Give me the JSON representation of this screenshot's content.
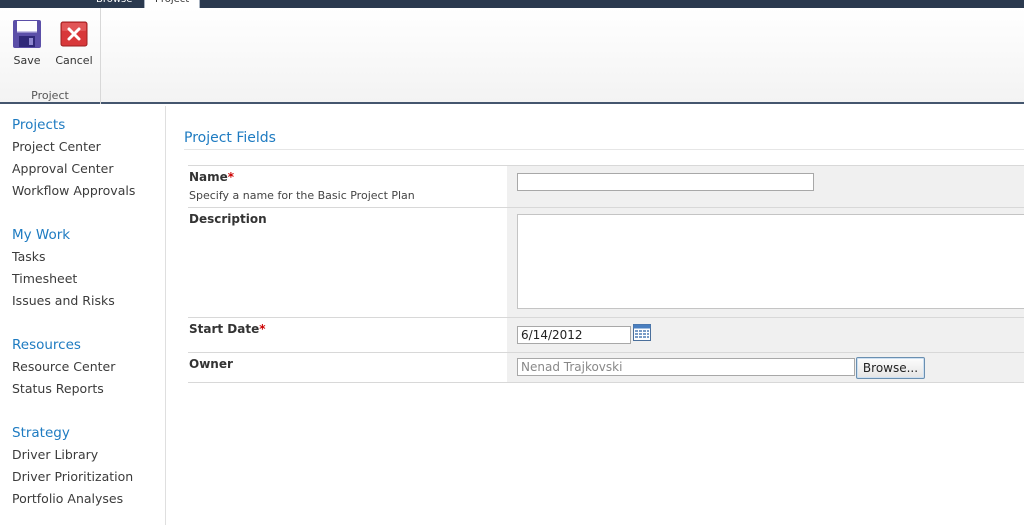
{
  "tabs": {
    "browse": "Browse",
    "project": "Project"
  },
  "ribbon": {
    "save_label": "Save",
    "cancel_label": "Cancel",
    "group_label": "Project"
  },
  "nav": {
    "projects": {
      "heading": "Projects",
      "items": [
        "Project Center",
        "Approval Center",
        "Workflow Approvals"
      ]
    },
    "my_work": {
      "heading": "My Work",
      "items": [
        "Tasks",
        "Timesheet",
        "Issues and Risks"
      ]
    },
    "resources": {
      "heading": "Resources",
      "items": [
        "Resource Center",
        "Status Reports"
      ]
    },
    "strategy": {
      "heading": "Strategy",
      "items": [
        "Driver Library",
        "Driver Prioritization",
        "Portfolio Analyses"
      ]
    }
  },
  "page": {
    "title": "Project Fields"
  },
  "form": {
    "name": {
      "label": "Name",
      "required": "*",
      "description": "Specify a name for the Basic Project Plan",
      "value": ""
    },
    "description": {
      "label": "Description",
      "value": ""
    },
    "start_date": {
      "label": "Start Date",
      "required": "*",
      "value": "6/14/2012"
    },
    "owner": {
      "label": "Owner",
      "value": "Nenad Trajkovski",
      "browse_label": "Browse..."
    }
  },
  "colors": {
    "accent": "#1e7bc1",
    "required": "#cc0000",
    "topbar": "#2b3a4f"
  },
  "icons": {
    "save": "floppy-disk-icon",
    "cancel": "cancel-x-icon",
    "calendar": "calendar-icon"
  }
}
